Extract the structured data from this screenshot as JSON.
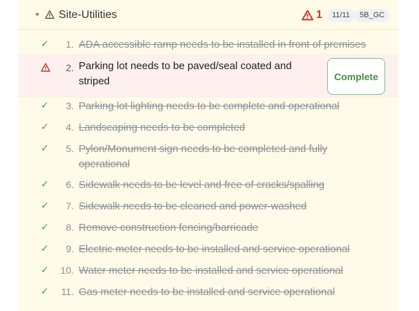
{
  "section": {
    "title": "Site-Utilities",
    "alert_count": "1",
    "progress": "11/11",
    "code": "5B_GC"
  },
  "colors": {
    "accent_green": "#3aa15a",
    "alert_red": "#c0392b",
    "panel_bg": "#fffbe8"
  },
  "icons": {
    "done": "check-icon",
    "issue": "warning-icon",
    "collapse": "caret-down-icon"
  },
  "check_glyph": "✓",
  "items": [
    {
      "num": "1.",
      "text": "ADA accessible ramp needs to be installed in front of premises",
      "done": true
    },
    {
      "num": "2.",
      "text": "Parking lot needs to be paved/seal coated and striped",
      "done": false,
      "action": "Complete"
    },
    {
      "num": "3.",
      "text": "Parking lot lighting needs to be complete and operational",
      "done": true
    },
    {
      "num": "4.",
      "text": "Landscaping needs to be completed",
      "done": true
    },
    {
      "num": "5.",
      "text": "Pylon/Monument sign needs to be completed and fully operational",
      "done": true
    },
    {
      "num": "6.",
      "text": "Sidewalk needs to be level and free of cracks/spalling",
      "done": true
    },
    {
      "num": "7.",
      "text": "Sidewalk needs to be cleaned and power-washed",
      "done": true
    },
    {
      "num": "8.",
      "text": "Remove construction fencing/barricade",
      "done": true
    },
    {
      "num": "9.",
      "text": "Electric meter needs to be installed and service operational",
      "done": true
    },
    {
      "num": "10.",
      "text": "Water meter needs to be installed and service operational",
      "done": true
    },
    {
      "num": "11.",
      "text": "Gas meter needs to be installed and service operational",
      "done": true
    }
  ]
}
